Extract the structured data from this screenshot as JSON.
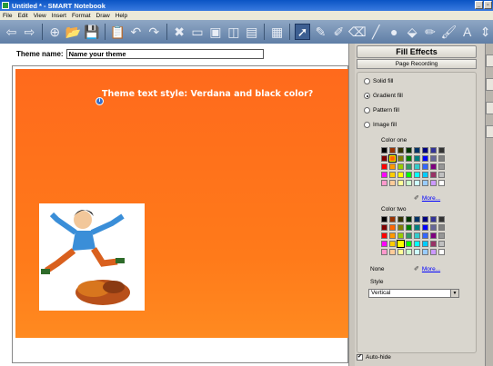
{
  "window": {
    "title": "Untitled * - SMART Notebook"
  },
  "menu": [
    "File",
    "Edit",
    "View",
    "Insert",
    "Format",
    "Draw",
    "Help"
  ],
  "toolbar": {
    "icons": [
      "back-arrow-icon",
      "forward-arrow-icon",
      "add-page-icon",
      "open-folder-icon",
      "save-icon",
      "paste-icon",
      "undo-icon",
      "redo-icon",
      "delete-icon",
      "screen-shade-icon",
      "display-icon",
      "capture-icon",
      "doc-camera-icon",
      "table-icon",
      "select-pointer-icon",
      "pen-icon",
      "creative-pen-icon",
      "eraser-icon",
      "line-icon",
      "shapes-icon",
      "fill-icon",
      "magic-pen-icon",
      "properties-icon",
      "text-icon",
      "more-tools-icon"
    ],
    "glyphs": [
      "⇦",
      "⇨",
      "⊕",
      "📂",
      "💾",
      "📋",
      "↶",
      "↷",
      "✖",
      "▭",
      "▣",
      "◫",
      "▤",
      "▦",
      "➚",
      "✎",
      "✐",
      "⌫",
      "╱",
      "●",
      "⬙",
      "✏",
      "🖌",
      "A",
      "⇕"
    ]
  },
  "theme": {
    "name_label": "Theme name:",
    "name_value": "Name your theme",
    "text_style": "Theme text style: Verdana and black color?",
    "info_glyph": "i"
  },
  "panel": {
    "title": "Fill Effects",
    "tab": "Page Recording",
    "fill_options": [
      {
        "label": "Solid fill",
        "selected": false
      },
      {
        "label": "Gradient fill",
        "selected": true
      },
      {
        "label": "Pattern fill",
        "selected": false
      },
      {
        "label": "Image fill",
        "selected": false
      }
    ],
    "color_one_label": "Color one",
    "color_two_label": "Color two",
    "more_label": "More...",
    "none_label": "None",
    "style_label": "Style",
    "style_value": "Vertical",
    "autohide_label": "Auto-hide",
    "autohide_checked": "✔"
  },
  "palette": [
    "#000000",
    "#993300",
    "#333300",
    "#003300",
    "#003366",
    "#000080",
    "#333399",
    "#333333",
    "#800000",
    "#ff6600",
    "#808000",
    "#008000",
    "#008080",
    "#0000ff",
    "#666699",
    "#808080",
    "#ff0000",
    "#ff9900",
    "#99cc00",
    "#339966",
    "#33cccc",
    "#3366ff",
    "#800080",
    "#969696",
    "#ff00ff",
    "#ffcc00",
    "#ffff00",
    "#00ff00",
    "#00ffff",
    "#00ccff",
    "#993366",
    "#c0c0c0",
    "#ff99cc",
    "#ffcc99",
    "#ffff99",
    "#ccffcc",
    "#ccffff",
    "#99ccff",
    "#cc99ff",
    "#ffffff"
  ],
  "color_one_selected": 9,
  "color_two_selected": 26
}
